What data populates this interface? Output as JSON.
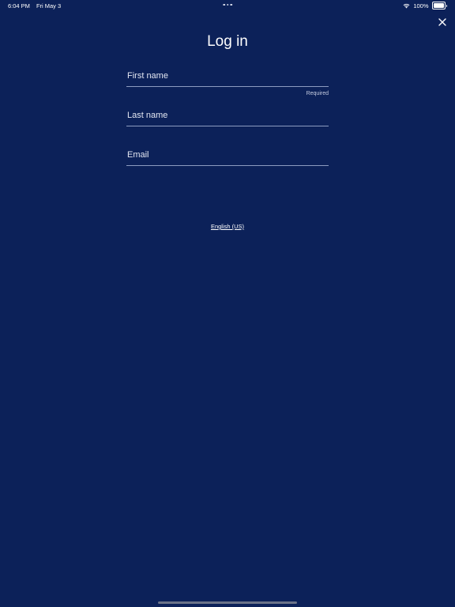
{
  "status_bar": {
    "time": "6:04 PM",
    "date": "Fri May 3",
    "battery_percent": "100%",
    "battery_level": 1.0,
    "icons": [
      "wifi-icon",
      "battery-icon"
    ]
  },
  "header": {
    "title": "Log in",
    "close_icon": "close-icon"
  },
  "form": {
    "first_name": {
      "placeholder": "First name",
      "value": "",
      "hint": "Required"
    },
    "last_name": {
      "placeholder": "Last name",
      "value": ""
    },
    "email": {
      "placeholder": "Email",
      "value": ""
    }
  },
  "footer": {
    "language": "English (US)"
  },
  "colors": {
    "background": "#0c2159",
    "text": "#ffffff",
    "field_underline": "#8d9bc0"
  }
}
